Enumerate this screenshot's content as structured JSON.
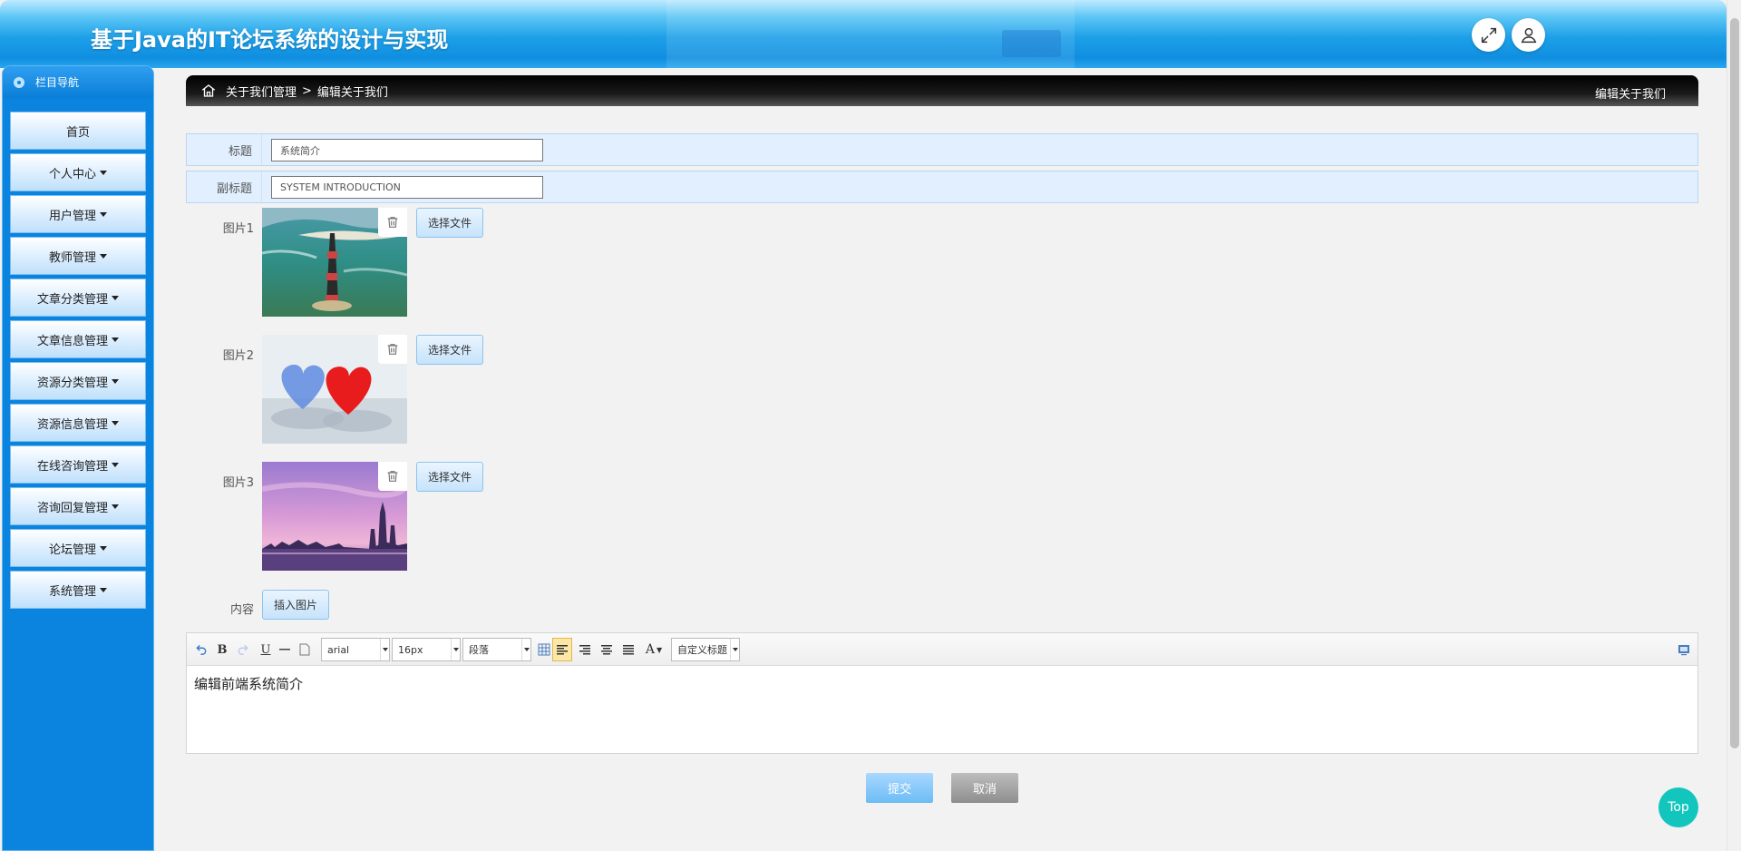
{
  "header": {
    "title": "基于Java的IT论坛系统的设计与实现"
  },
  "sidebar": {
    "title": "栏目导航",
    "items": [
      {
        "label": "首页",
        "dropdown": false
      },
      {
        "label": "个人中心",
        "dropdown": true
      },
      {
        "label": "用户管理",
        "dropdown": true
      },
      {
        "label": "教师管理",
        "dropdown": true
      },
      {
        "label": "文章分类管理",
        "dropdown": true
      },
      {
        "label": "文章信息管理",
        "dropdown": true
      },
      {
        "label": "资源分类管理",
        "dropdown": true
      },
      {
        "label": "资源信息管理",
        "dropdown": true
      },
      {
        "label": "在线咨询管理",
        "dropdown": true
      },
      {
        "label": "咨询回复管理",
        "dropdown": true
      },
      {
        "label": "论坛管理",
        "dropdown": true
      },
      {
        "label": "系统管理",
        "dropdown": true
      }
    ]
  },
  "breadcrumb": {
    "path": "关于我们管理",
    "separator": ">",
    "current": "编辑关于我们",
    "right_title": "编辑关于我们"
  },
  "form": {
    "title": {
      "label": "标题",
      "value": "系统简介"
    },
    "subtitle": {
      "label": "副标题",
      "value": "SYSTEM INTRODUCTION"
    },
    "pictures": [
      {
        "label": "图片1",
        "button": "选择文件"
      },
      {
        "label": "图片2",
        "button": "选择文件"
      },
      {
        "label": "图片3",
        "button": "选择文件"
      }
    ],
    "content": {
      "label": "内容",
      "insert_button": "插入图片"
    }
  },
  "editor": {
    "font_family": "arial",
    "font_size": "16px",
    "paragraph": "段落",
    "custom_heading": "自定义标题",
    "text": "编辑前端系统简介"
  },
  "actions": {
    "submit": "提交",
    "cancel": "取消"
  },
  "top_button": "Top"
}
